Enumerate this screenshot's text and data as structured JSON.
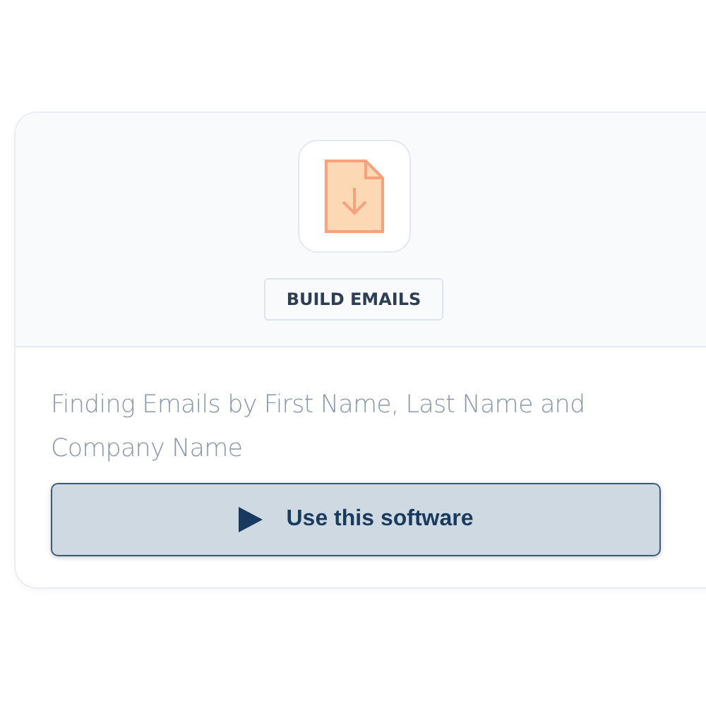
{
  "card": {
    "category_button": "BUILD EMAILS",
    "description": "Finding Emails by First Name, Last Name and Company Name",
    "action_button": "Use this software"
  }
}
